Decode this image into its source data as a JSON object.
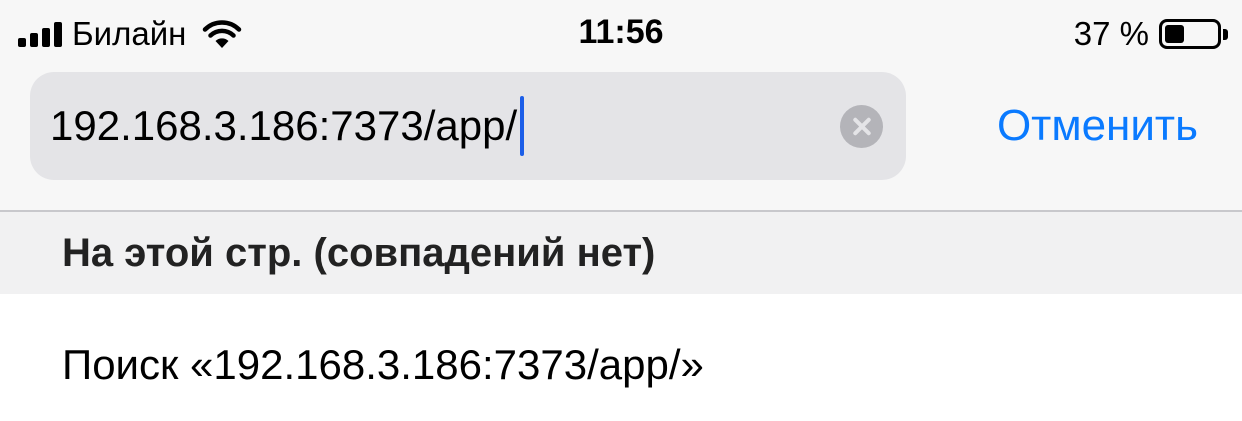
{
  "status_bar": {
    "carrier": "Билайн",
    "time": "11:56",
    "battery_percent": "37 %",
    "battery_level": 0.37,
    "signal_bars": 4,
    "icons": [
      "signal-icon",
      "wifi-icon",
      "battery-icon"
    ]
  },
  "search": {
    "value": "192.168.3.186:7373/app/",
    "clear_icon": "clear-icon",
    "cancel_label": "Отменить"
  },
  "section": {
    "header": "На этой стр. (совпадений нет)"
  },
  "suggestions": [
    {
      "label": "Поиск «192.168.3.186:7373/app/»"
    }
  ],
  "colors": {
    "accent": "#0a7aff",
    "caret": "#1c5ee8",
    "field_background": "#e4e4e7",
    "header_background": "#f1f1f2"
  }
}
